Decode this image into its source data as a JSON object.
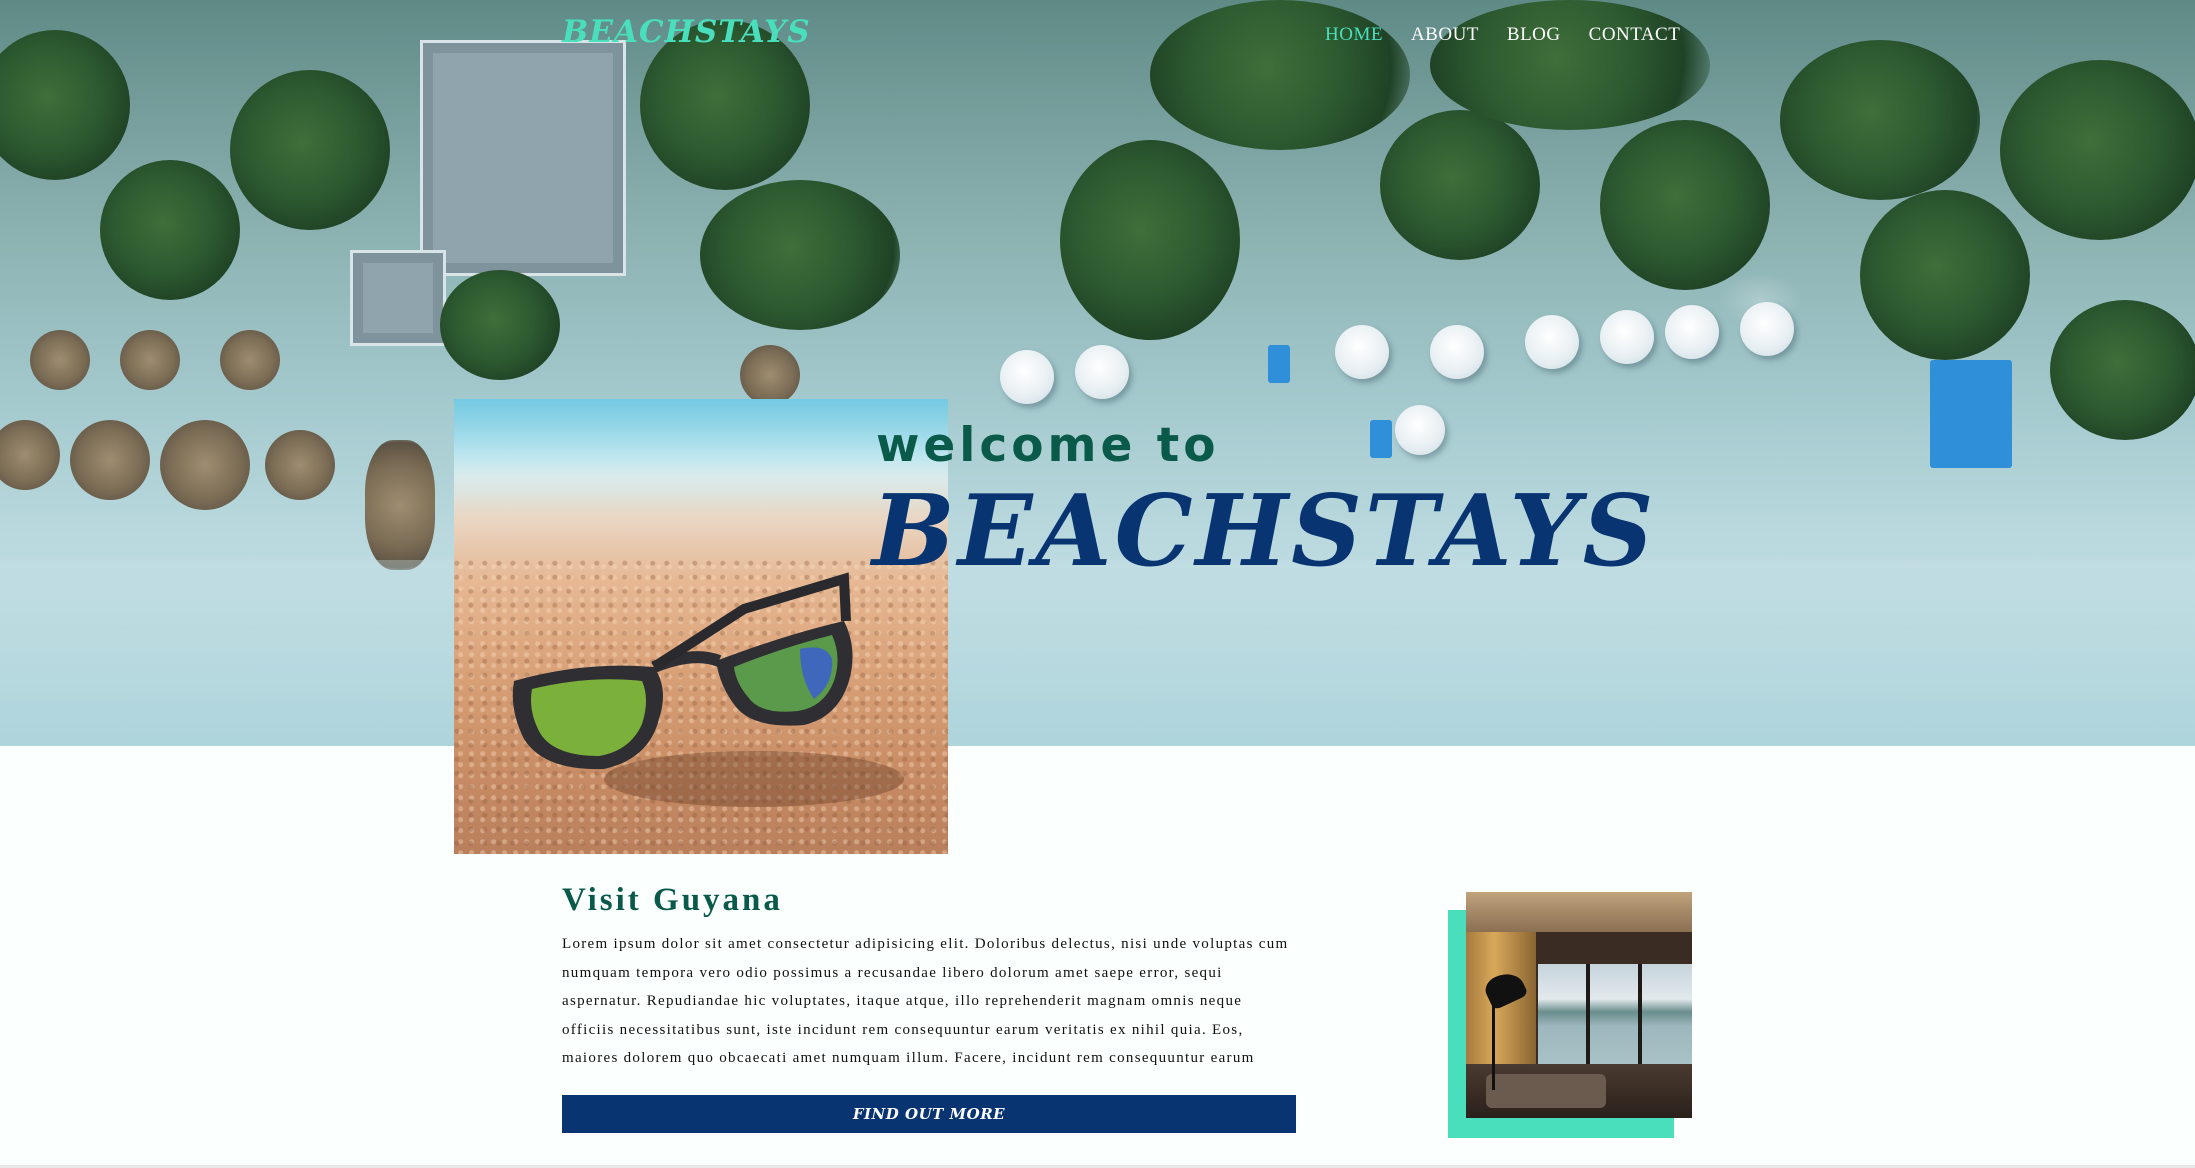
{
  "header": {
    "logo": "BEACHSTAYS",
    "nav": [
      {
        "label": "HOME",
        "active": true
      },
      {
        "label": "ABOUT",
        "active": false
      },
      {
        "label": "BLOG",
        "active": false
      },
      {
        "label": "CONTACT",
        "active": false
      }
    ]
  },
  "hero": {
    "welcome": "welcome to",
    "brand": "BEACHSTAYS",
    "background": "aerial-beach-photo",
    "feature_image": "sunglasses-on-sand-photo"
  },
  "section": {
    "title": "Visit Guyana",
    "body": "Lorem ipsum dolor sit amet consectetur adipisicing elit. Doloribus delectus, nisi unde voluptas cum numquam tempora vero odio possimus a recusandae libero dolorum amet saepe error, sequi aspernatur. Repudiandae hic voluptates, itaque atque, illo reprehenderit magnam omnis neque officiis necessitatibus sunt, iste incidunt rem consequuntur earum veritatis ex nihil quia. Eos, maiores dolorem quo obcaecati amet numquam illum. Facere, incidunt rem consequuntur earum",
    "cta": "FIND OUT MORE",
    "side_image": "lounge-room-photo"
  },
  "colors": {
    "accent": "#49dfbd",
    "navy": "#083572",
    "teal_text": "#0a5a4a",
    "background": "#fbfffd"
  }
}
